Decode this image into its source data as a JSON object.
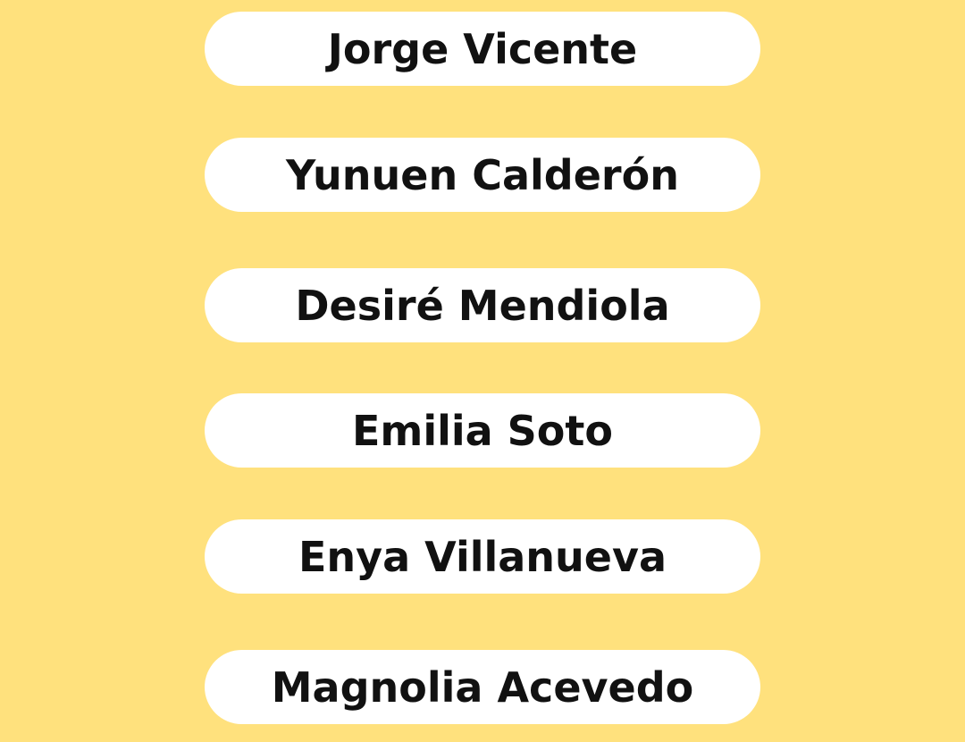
{
  "theme": {
    "background": "#ffe17d",
    "pill": "#ffffff",
    "text": "#111111"
  },
  "names": [
    {
      "label": "Jorge Vicente"
    },
    {
      "label": "Yunuen Calderón"
    },
    {
      "label": "Desiré Mendiola"
    },
    {
      "label": "Emilia Soto"
    },
    {
      "label": "Enya Villanueva"
    },
    {
      "label": "Magnolia Acevedo"
    }
  ]
}
